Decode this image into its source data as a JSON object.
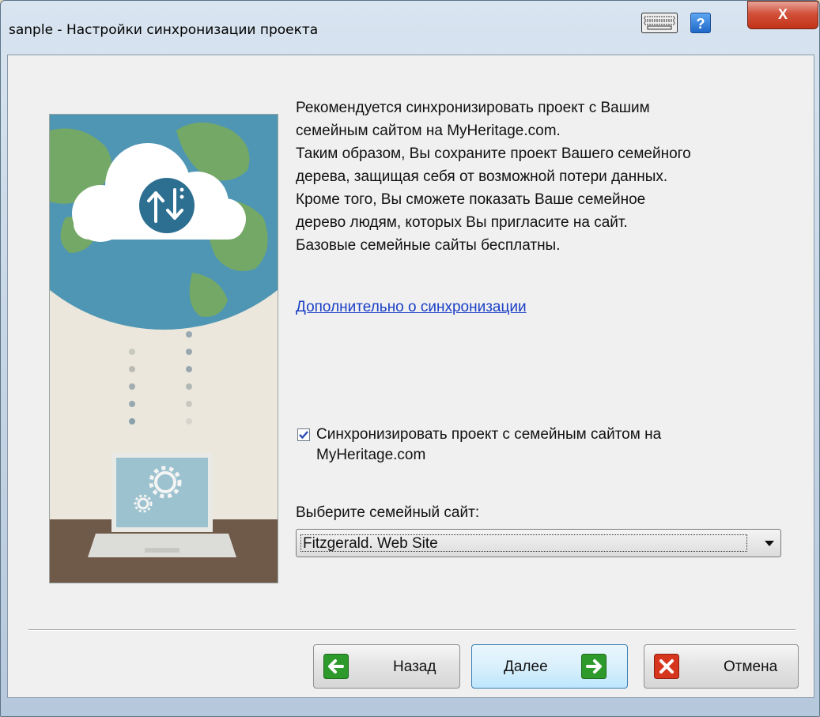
{
  "window": {
    "title": "sanple - Настройки синхронизации проекта",
    "help_label": "?",
    "close_label": "X"
  },
  "description": {
    "lines": [
      "Рекомендуется синхронизировать проект с Вашим",
      "семейным сайтом на MyHeritage.com.",
      "Таким образом, Вы сохраните проект Вашего семейного",
      "дерева, защищая себя от возможной потери данных.",
      "Кроме того, Вы сможете показать Ваше семейное",
      "дерево людям, которых Вы пригласите на сайт.",
      "Базовые семейные сайты бесплатны."
    ]
  },
  "more_link": "Дополнительно о синхронизации",
  "sync": {
    "checked": true,
    "label_line1": "Синхронизировать проект с семейным сайтом на",
    "label_line2": "MyHeritage.com"
  },
  "site": {
    "label": "Выберите семейный сайт:",
    "selected": "Fitzgerald. Web Site"
  },
  "buttons": {
    "back": "Назад",
    "next": "Далее",
    "cancel": "Отмена"
  },
  "colors": {
    "link": "#1a3fc7",
    "globe_ocean": "#4f96b4",
    "globe_land": "#74a866",
    "sync_icon": "#2d6f91",
    "laptop_screen": "#9cc2cf",
    "table": "#6f5a4a",
    "arrow_green": "#2f9a2c",
    "cancel_red": "#d7361e"
  },
  "icons": [
    "keyboard-icon",
    "help-icon",
    "close-icon",
    "cloud-sync-icon",
    "gear-icon",
    "back-arrow-icon",
    "next-arrow-icon",
    "cancel-x-icon",
    "checkmark-icon",
    "chevron-down-icon"
  ]
}
